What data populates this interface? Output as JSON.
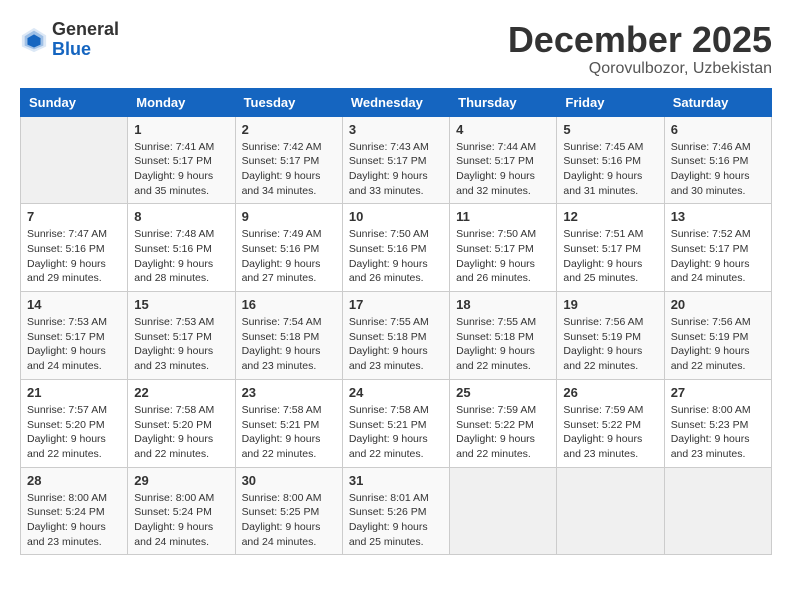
{
  "header": {
    "logo": {
      "general": "General",
      "blue": "Blue"
    },
    "title": "December 2025",
    "location": "Qorovulbozor, Uzbekistan"
  },
  "calendar": {
    "days_of_week": [
      "Sunday",
      "Monday",
      "Tuesday",
      "Wednesday",
      "Thursday",
      "Friday",
      "Saturday"
    ],
    "weeks": [
      [
        {
          "day": "",
          "info": ""
        },
        {
          "day": "1",
          "info": "Sunrise: 7:41 AM\nSunset: 5:17 PM\nDaylight: 9 hours\nand 35 minutes."
        },
        {
          "day": "2",
          "info": "Sunrise: 7:42 AM\nSunset: 5:17 PM\nDaylight: 9 hours\nand 34 minutes."
        },
        {
          "day": "3",
          "info": "Sunrise: 7:43 AM\nSunset: 5:17 PM\nDaylight: 9 hours\nand 33 minutes."
        },
        {
          "day": "4",
          "info": "Sunrise: 7:44 AM\nSunset: 5:17 PM\nDaylight: 9 hours\nand 32 minutes."
        },
        {
          "day": "5",
          "info": "Sunrise: 7:45 AM\nSunset: 5:16 PM\nDaylight: 9 hours\nand 31 minutes."
        },
        {
          "day": "6",
          "info": "Sunrise: 7:46 AM\nSunset: 5:16 PM\nDaylight: 9 hours\nand 30 minutes."
        }
      ],
      [
        {
          "day": "7",
          "info": "Sunrise: 7:47 AM\nSunset: 5:16 PM\nDaylight: 9 hours\nand 29 minutes."
        },
        {
          "day": "8",
          "info": "Sunrise: 7:48 AM\nSunset: 5:16 PM\nDaylight: 9 hours\nand 28 minutes."
        },
        {
          "day": "9",
          "info": "Sunrise: 7:49 AM\nSunset: 5:16 PM\nDaylight: 9 hours\nand 27 minutes."
        },
        {
          "day": "10",
          "info": "Sunrise: 7:50 AM\nSunset: 5:16 PM\nDaylight: 9 hours\nand 26 minutes."
        },
        {
          "day": "11",
          "info": "Sunrise: 7:50 AM\nSunset: 5:17 PM\nDaylight: 9 hours\nand 26 minutes."
        },
        {
          "day": "12",
          "info": "Sunrise: 7:51 AM\nSunset: 5:17 PM\nDaylight: 9 hours\nand 25 minutes."
        },
        {
          "day": "13",
          "info": "Sunrise: 7:52 AM\nSunset: 5:17 PM\nDaylight: 9 hours\nand 24 minutes."
        }
      ],
      [
        {
          "day": "14",
          "info": "Sunrise: 7:53 AM\nSunset: 5:17 PM\nDaylight: 9 hours\nand 24 minutes."
        },
        {
          "day": "15",
          "info": "Sunrise: 7:53 AM\nSunset: 5:17 PM\nDaylight: 9 hours\nand 23 minutes."
        },
        {
          "day": "16",
          "info": "Sunrise: 7:54 AM\nSunset: 5:18 PM\nDaylight: 9 hours\nand 23 minutes."
        },
        {
          "day": "17",
          "info": "Sunrise: 7:55 AM\nSunset: 5:18 PM\nDaylight: 9 hours\nand 23 minutes."
        },
        {
          "day": "18",
          "info": "Sunrise: 7:55 AM\nSunset: 5:18 PM\nDaylight: 9 hours\nand 22 minutes."
        },
        {
          "day": "19",
          "info": "Sunrise: 7:56 AM\nSunset: 5:19 PM\nDaylight: 9 hours\nand 22 minutes."
        },
        {
          "day": "20",
          "info": "Sunrise: 7:56 AM\nSunset: 5:19 PM\nDaylight: 9 hours\nand 22 minutes."
        }
      ],
      [
        {
          "day": "21",
          "info": "Sunrise: 7:57 AM\nSunset: 5:20 PM\nDaylight: 9 hours\nand 22 minutes."
        },
        {
          "day": "22",
          "info": "Sunrise: 7:58 AM\nSunset: 5:20 PM\nDaylight: 9 hours\nand 22 minutes."
        },
        {
          "day": "23",
          "info": "Sunrise: 7:58 AM\nSunset: 5:21 PM\nDaylight: 9 hours\nand 22 minutes."
        },
        {
          "day": "24",
          "info": "Sunrise: 7:58 AM\nSunset: 5:21 PM\nDaylight: 9 hours\nand 22 minutes."
        },
        {
          "day": "25",
          "info": "Sunrise: 7:59 AM\nSunset: 5:22 PM\nDaylight: 9 hours\nand 22 minutes."
        },
        {
          "day": "26",
          "info": "Sunrise: 7:59 AM\nSunset: 5:22 PM\nDaylight: 9 hours\nand 23 minutes."
        },
        {
          "day": "27",
          "info": "Sunrise: 8:00 AM\nSunset: 5:23 PM\nDaylight: 9 hours\nand 23 minutes."
        }
      ],
      [
        {
          "day": "28",
          "info": "Sunrise: 8:00 AM\nSunset: 5:24 PM\nDaylight: 9 hours\nand 23 minutes."
        },
        {
          "day": "29",
          "info": "Sunrise: 8:00 AM\nSunset: 5:24 PM\nDaylight: 9 hours\nand 24 minutes."
        },
        {
          "day": "30",
          "info": "Sunrise: 8:00 AM\nSunset: 5:25 PM\nDaylight: 9 hours\nand 24 minutes."
        },
        {
          "day": "31",
          "info": "Sunrise: 8:01 AM\nSunset: 5:26 PM\nDaylight: 9 hours\nand 25 minutes."
        },
        {
          "day": "",
          "info": ""
        },
        {
          "day": "",
          "info": ""
        },
        {
          "day": "",
          "info": ""
        }
      ]
    ]
  }
}
